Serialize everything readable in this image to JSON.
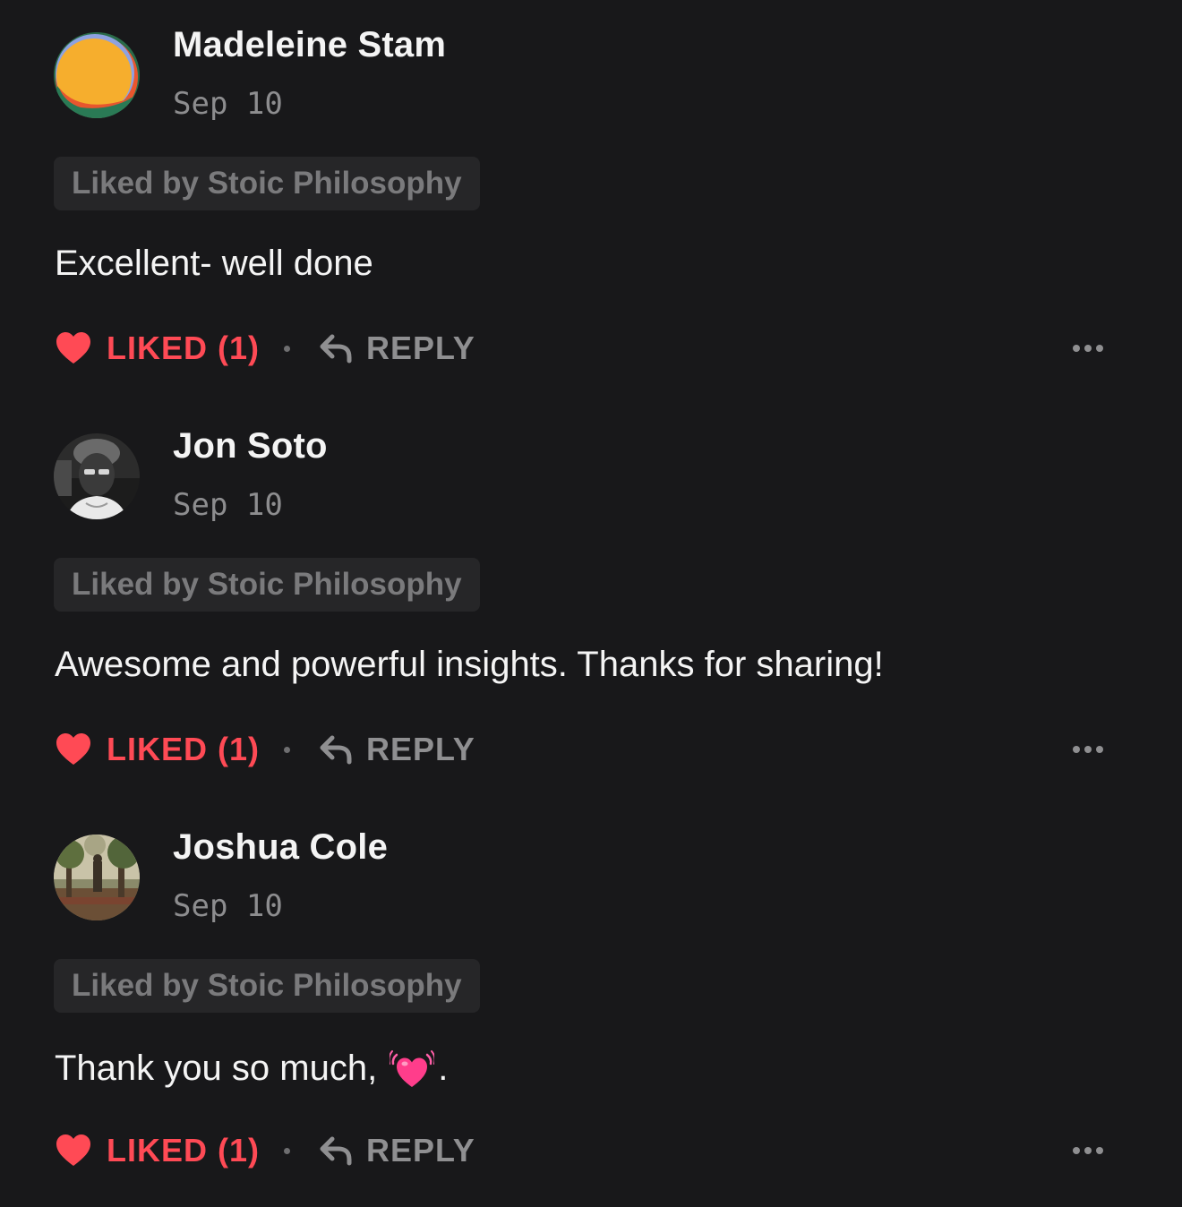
{
  "comments": [
    {
      "author": "Madeleine Stam",
      "date": "Sep 10",
      "liked_by": "Liked by Stoic Philosophy",
      "body": "Excellent- well done",
      "emoji": "",
      "trailing": "",
      "like_label": "LIKED (1)",
      "reply_label": "REPLY",
      "avatar": "colorful-circle-avatar"
    },
    {
      "author": "Jon Soto",
      "date": "Sep 10",
      "liked_by": "Liked by Stoic Philosophy",
      "body": "Awesome and powerful insights. Thanks for sharing!",
      "emoji": "",
      "trailing": "",
      "like_label": "LIKED (1)",
      "reply_label": "REPLY",
      "avatar": "portrait-photo-avatar"
    },
    {
      "author": "Joshua Cole",
      "date": "Sep 10",
      "liked_by": "Liked by Stoic Philosophy",
      "body": "Thank you so much,",
      "emoji": "pink-heart-emoji",
      "trailing": ".",
      "like_label": "LIKED (1)",
      "reply_label": "REPLY",
      "avatar": "forest-photo-avatar"
    }
  ],
  "icons": {
    "like": "heart-icon",
    "reply": "reply-arrow-icon",
    "more": "more-options-icon"
  },
  "colors": {
    "background": "#18181a",
    "liked": "#ff4a55",
    "muted": "#8f8f91",
    "badge_bg": "#262628"
  }
}
